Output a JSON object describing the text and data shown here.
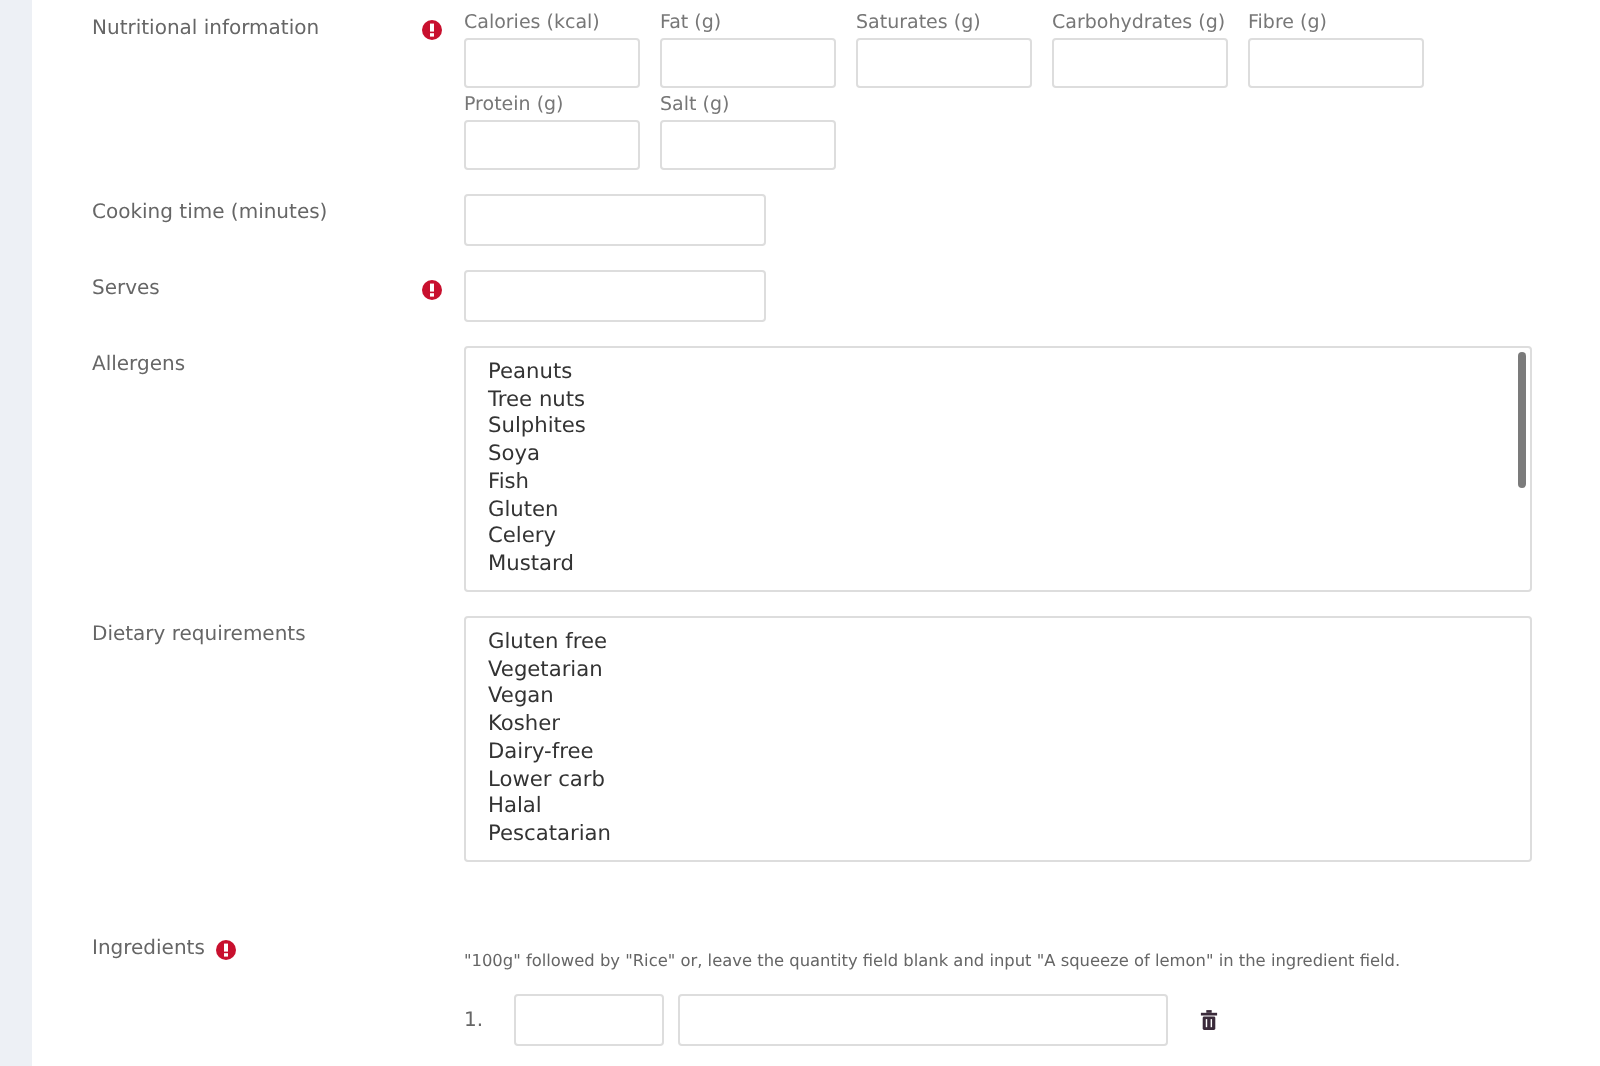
{
  "fields": [
    {
      "kind": "nutrition",
      "label": "Nutritional information",
      "required": true,
      "inputs": [
        {
          "label": "Calories (kcal)"
        },
        {
          "label": "Fat (g)"
        },
        {
          "label": "Saturates (g)"
        },
        {
          "label": "Carbohydrates (g)"
        },
        {
          "label": "Fibre (g)"
        },
        {
          "label": "Protein (g)"
        },
        {
          "label": "Salt (g)"
        }
      ]
    },
    {
      "kind": "text",
      "label": "Cooking time (minutes)",
      "required": false
    },
    {
      "kind": "text",
      "label": "Serves",
      "required": true
    },
    {
      "kind": "listbox",
      "label": "Allergens",
      "required": false,
      "scrollbar": true,
      "options": [
        "Peanuts",
        "Tree nuts",
        "Sulphites",
        "Soya",
        "Fish",
        "Gluten",
        "Celery",
        "Mustard"
      ]
    },
    {
      "kind": "listbox",
      "label": "Dietary requirements",
      "required": false,
      "options": [
        "Gluten free",
        "Vegetarian",
        "Vegan",
        "Kosher",
        "Dairy-free",
        "Lower carb",
        "Halal",
        "Pescatarian"
      ]
    },
    {
      "kind": "ingredients",
      "label": "Ingredients",
      "required": true,
      "hint": "\"100g\" followed by \"Rice\" or, leave the quantity field blank and input \"A squeeze of lemon\" in the ingredient field.",
      "rows": [
        {
          "number": "1."
        }
      ]
    }
  ]
}
